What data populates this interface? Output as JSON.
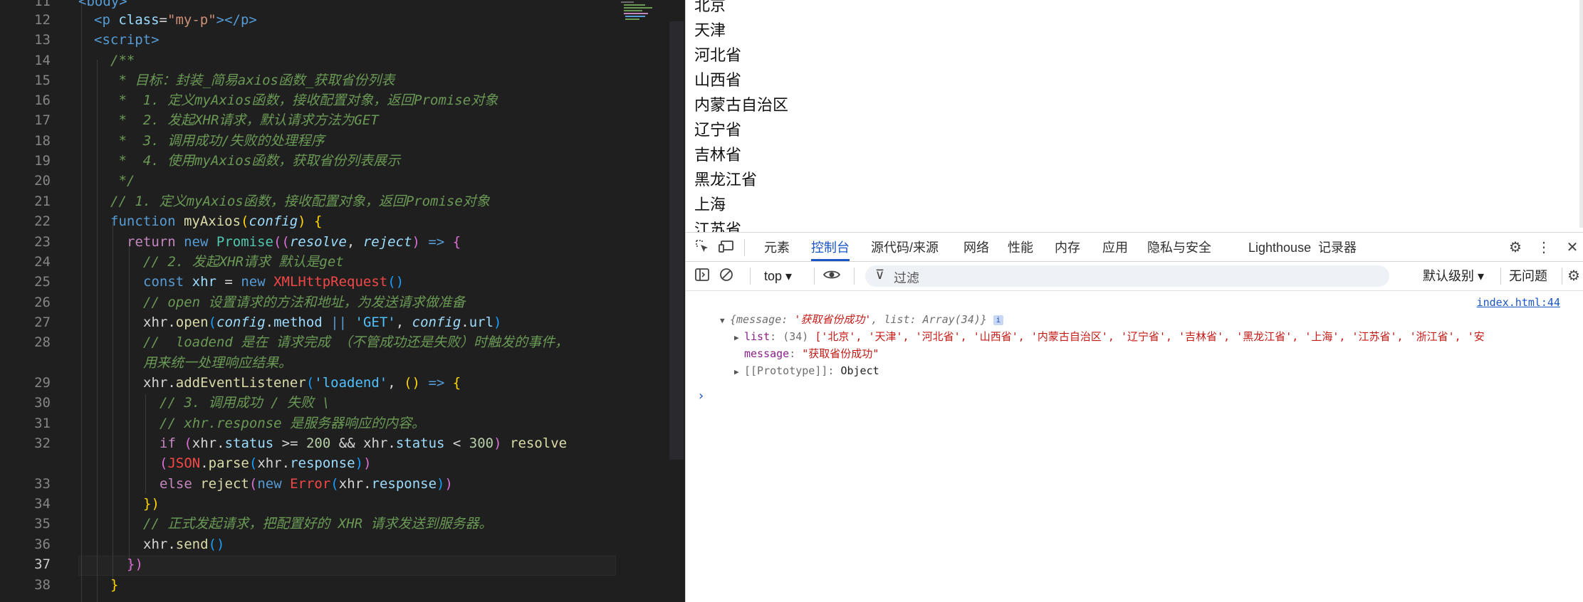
{
  "editor": {
    "line_numbers": [
      "11",
      "12",
      "13",
      "14",
      "15",
      "16",
      "17",
      "18",
      "19",
      "20",
      "21",
      "22",
      "23",
      "24",
      "25",
      "26",
      "27",
      "28",
      "",
      "29",
      "30",
      "31",
      "32",
      "",
      "33",
      "34",
      "35",
      "36",
      "37",
      "38"
    ],
    "active_line": "37",
    "lines": {
      "l11": "<body>",
      "l12_tag_open": "<p",
      "l12_attr": "class",
      "l12_eq": "=",
      "l12_val": "\"my-p\"",
      "l12_rest": "></p>",
      "l13": "<script>",
      "l14": "/**",
      "l15": " * 目标：封装_简易axios函数_获取省份列表",
      "l16": " *  1. 定义myAxios函数，接收配置对象，返回Promise对象",
      "l17": " *  2. 发起XHR请求，默认请求方法为GET",
      "l18": " *  3. 调用成功/失败的处理程序",
      "l19": " *  4. 使用myAxios函数，获取省份列表展示",
      "l20": " */",
      "l21": "// 1. 定义myAxios函数，接收配置对象，返回Promise对象",
      "l22_kw": "function",
      "l22_fn": "myAxios",
      "l22_param": "config",
      "l23_kw": "return",
      "l23_new": "new",
      "l23_cls": "Promise",
      "l23_p1": "resolve",
      "l23_p2": "reject",
      "l24": "// 2. 发起XHR请求 默认是get",
      "l25_kw": "const",
      "l25_var": "xhr",
      "l25_new": "new",
      "l25_cls": "XMLHttpRequest",
      "l26": "// open 设置请求的方法和地址，为发送请求做准备",
      "l27_obj": "xhr",
      "l27_fn": "open",
      "l27_p": "config",
      "l27_prop": "method",
      "l27_str": "'GET'",
      "l27_prop2": "url",
      "l28a": "//  loadend 是在 请求完成 （不管成功还是失败）时触发的事件，",
      "l28b": "用来统一处理响应结果。",
      "l29_obj": "xhr",
      "l29_fn": "addEventListener",
      "l29_str": "'loadend'",
      "l30": "// 3. 调用成功 / 失败 \\",
      "l31": "// xhr.response 是服务器响应的内容。",
      "l32_kw": "if",
      "l32_obj": "xhr",
      "l32_prop": "status",
      "l32_n1": "200",
      "l32_n2": "300",
      "l32_fn": "resolve",
      "l32b_cls": "JSON",
      "l32b_fn": "parse",
      "l32b_obj": "xhr",
      "l32b_prop": "response",
      "l33_kw": "else",
      "l33_fn": "reject",
      "l33_new": "new",
      "l33_cls": "Error",
      "l33_obj": "xhr",
      "l33_prop": "response",
      "l34": "})",
      "l35": "// 正式发起请求，把配置好的 XHR 请求发送到服务器。",
      "l36_obj": "xhr",
      "l36_fn": "send",
      "l37": "})",
      "l38": "}"
    }
  },
  "preview": {
    "provinces": [
      "北京",
      "天津",
      "河北省",
      "山西省",
      "内蒙古自治区",
      "辽宁省",
      "吉林省",
      "黑龙江省",
      "上海",
      "江苏省"
    ]
  },
  "devtools": {
    "tabs": [
      "元素",
      "控制台",
      "源代码/来源",
      "网络",
      "性能",
      "内存",
      "应用",
      "隐私与安全",
      "Lighthouse",
      "记录器"
    ],
    "active_tab": "控制台",
    "context": "top",
    "filter_placeholder": "过滤",
    "level": "默认级别",
    "issues": "无问题",
    "console": {
      "source_link": "index.html:44",
      "object_summary_open": "{",
      "message_key": "message",
      "message_value": "'获取省份成功'",
      "list_key": "list",
      "list_summary": "Array(34)",
      "object_summary_close": "}",
      "list_prop": "list",
      "list_count": "(34)",
      "list_preview": "['北京', '天津', '河北省', '山西省', '内蒙古自治区', '辽宁省', '吉林省', '黑龙江省', '上海', '江苏省', '浙江省', '安",
      "message_prop": "message",
      "message_full": "\"获取省份成功\"",
      "proto": "[[Prototype]]",
      "proto_value": "Object",
      "info_badge": "i",
      "prompt": "›"
    }
  },
  "colors": {
    "accent": "#1a56c4",
    "editor_bg": "#1f1f1f",
    "comment": "#6a9955"
  }
}
